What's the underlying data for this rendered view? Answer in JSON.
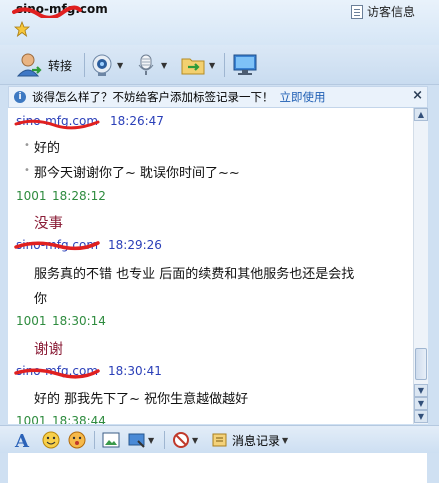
{
  "header": {
    "contact_name": "sino-mfg.com",
    "visitor_info_label": "访客信息"
  },
  "toolbar": {
    "transfer_label": "转接"
  },
  "notice": {
    "text": "谈得怎么样了？不妨给客户添加标签记录一下！",
    "link": "立即使用",
    "close": "×"
  },
  "chat": {
    "messages": [
      {
        "sender": "sino-mfg.com",
        "time": "18:26:47",
        "lines": [
          "好的",
          "那今天谢谢你了~  耽误你时间了~~"
        ]
      },
      {
        "sender": "1001",
        "time": "18:28:12",
        "lines": [
          "没事"
        ]
      },
      {
        "sender": "sino-mfg.com",
        "time": "18:29:26",
        "lines": [
          "服务真的不错  也专业  后面的续费和其他服务也还是会找",
          "你"
        ]
      },
      {
        "sender": "1001",
        "time": "18:30:14",
        "lines": [
          "谢谢"
        ]
      },
      {
        "sender": "sino-mfg.com",
        "time": "18:30:41",
        "lines": [
          "好的   那我先下了~  祝你生意越做越好"
        ]
      },
      {
        "sender": "1001",
        "time": "18:38:44",
        "lines": []
      }
    ]
  },
  "bottom_toolbar": {
    "message_log_label": "消息记录"
  },
  "colors": {
    "sender_blue": "#2a3fb8",
    "self_green": "#2e8b3e",
    "self_text_red": "#8a1c36",
    "link_blue": "#1f5fb4",
    "redaction_red": "#e02020"
  }
}
